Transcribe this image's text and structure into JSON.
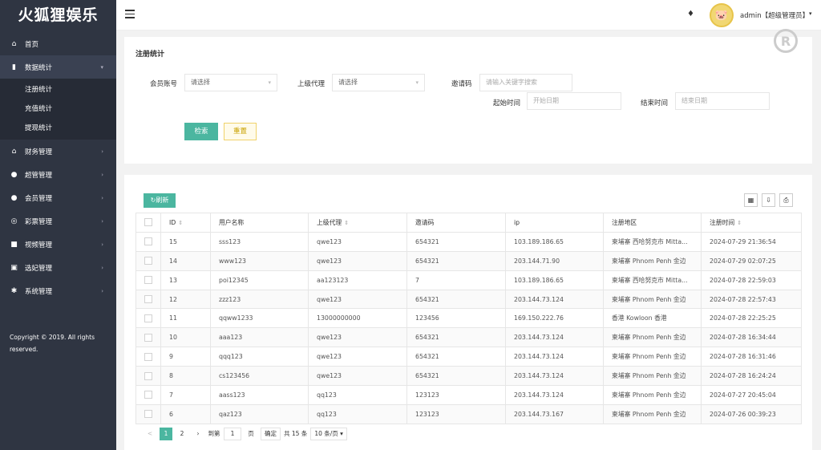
{
  "brand": "火狐狸娱乐",
  "sidebar": {
    "items": [
      {
        "label": "首页",
        "icon": "home-icon"
      },
      {
        "label": "数据统计",
        "icon": "bar-chart-icon"
      },
      {
        "label": "财务管理",
        "icon": "bank-icon"
      },
      {
        "label": "超管管理",
        "icon": "user-icon"
      },
      {
        "label": "会员管理",
        "icon": "users-icon"
      },
      {
        "label": "彩票管理",
        "icon": "gamepad-icon"
      },
      {
        "label": "视频管理",
        "icon": "video-icon"
      },
      {
        "label": "选妃管理",
        "icon": "ticket-icon"
      },
      {
        "label": "系统管理",
        "icon": "gear-icon"
      }
    ],
    "sub_items": [
      "注册统计",
      "充值统计",
      "提现统计"
    ],
    "copyright": "Copyright © 2019. All rights reserved."
  },
  "header": {
    "user": "admin【超级管理员】"
  },
  "filter": {
    "title": "注册统计",
    "member_label": "会员账号",
    "member_placeholder": "请选择",
    "agent_label": "上级代理",
    "agent_placeholder": "请选择",
    "invite_label": "邀请码",
    "invite_placeholder": "请输入关键字搜索",
    "start_label": "起始时间",
    "start_placeholder": "开始日期",
    "end_label": "结束时间",
    "end_placeholder": "结束日期",
    "search_button": "检索",
    "reset_button": "重置"
  },
  "table": {
    "refresh_button": "刷新",
    "headers": [
      "ID",
      "用户名称",
      "上级代理",
      "邀请码",
      "ip",
      "注册地区",
      "注册时间"
    ],
    "rows": [
      [
        "15",
        "sss123",
        "qwe123",
        "654321",
        "103.189.186.65",
        "柬埔寨 西哈努克市 Mitta...",
        "2024-07-29 21:36:54"
      ],
      [
        "14",
        "www123",
        "qwe123",
        "654321",
        "203.144.71.90",
        "柬埔寨 Phnom Penh 金边",
        "2024-07-29 02:07:25"
      ],
      [
        "13",
        "poi12345",
        "aa123123",
        "7",
        "103.189.186.65",
        "柬埔寨 西哈努克市 Mitta...",
        "2024-07-28 22:59:03"
      ],
      [
        "12",
        "zzz123",
        "qwe123",
        "654321",
        "203.144.73.124",
        "柬埔寨 Phnom Penh 金边",
        "2024-07-28 22:57:43"
      ],
      [
        "11",
        "qqww1233",
        "13000000000",
        "123456",
        "169.150.222.76",
        "香港 Kowloon 香港",
        "2024-07-28 22:25:25"
      ],
      [
        "10",
        "aaa123",
        "qwe123",
        "654321",
        "203.144.73.124",
        "柬埔寨 Phnom Penh 金边",
        "2024-07-28 16:34:44"
      ],
      [
        "9",
        "qqq123",
        "qwe123",
        "654321",
        "203.144.73.124",
        "柬埔寨 Phnom Penh 金边",
        "2024-07-28 16:31:46"
      ],
      [
        "8",
        "cs123456",
        "qwe123",
        "654321",
        "203.144.73.124",
        "柬埔寨 Phnom Penh 金边",
        "2024-07-28 16:24:24"
      ],
      [
        "7",
        "aass123",
        "qq123",
        "123123",
        "203.144.73.124",
        "柬埔寨 Phnom Penh 金边",
        "2024-07-27 20:45:04"
      ],
      [
        "6",
        "qaz123",
        "qq123",
        "123123",
        "203.144.73.167",
        "柬埔寨 Phnom Penh 金边",
        "2024-07-26 00:39:23"
      ]
    ]
  },
  "pager": {
    "prev": "<",
    "pages": [
      "1",
      "2"
    ],
    "goto_label": "到第",
    "page_value": "1",
    "page_unit": "页",
    "confirm": "确定",
    "total": "共 15 条",
    "page_size": "10 条/页"
  }
}
